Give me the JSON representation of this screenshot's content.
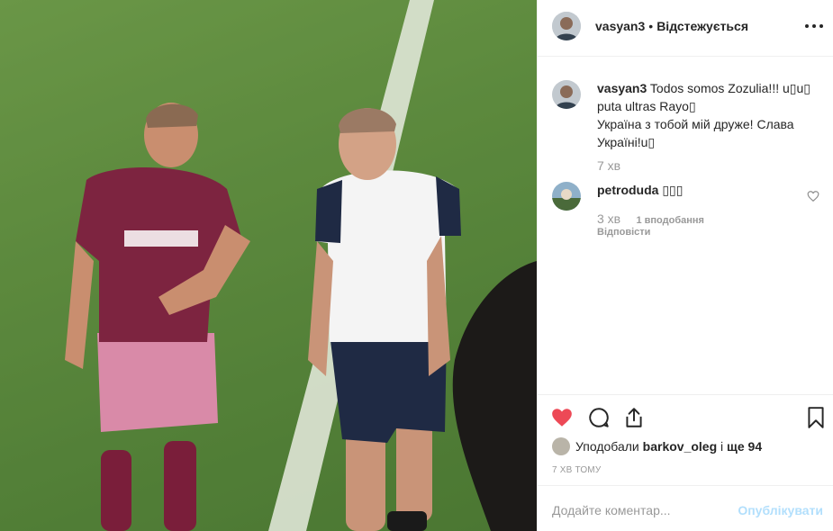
{
  "header": {
    "username": "vasyan3",
    "separator": "•",
    "follow_status": "Відстежується"
  },
  "comments": [
    {
      "username": "vasyan3",
      "text_line1": "Todos somos Zozulia!!! u▯u▯",
      "text_line2": "puta ultras Rayo▯",
      "text_line3": "Україна з тобой мій друже! Слава",
      "text_line4": "Україні!u▯",
      "time": "7 хв"
    },
    {
      "username": "petroduda",
      "text": "▯▯▯",
      "time": "3 хв",
      "likes": "1 вподобання",
      "reply": "Відповісти"
    }
  ],
  "actions": {
    "liked_prefix": "Уподобали",
    "liked_user": "barkov_oleg",
    "liked_connector": "і",
    "liked_rest": "ще 94",
    "posted_ago": "7 ХВ ТОМУ"
  },
  "add_comment": {
    "placeholder": "Додайте коментар...",
    "post_label": "Опублікувати"
  },
  "colors": {
    "heart_liked": "#ed4956",
    "post_disabled": "#b2dffc",
    "muted": "#999999"
  }
}
